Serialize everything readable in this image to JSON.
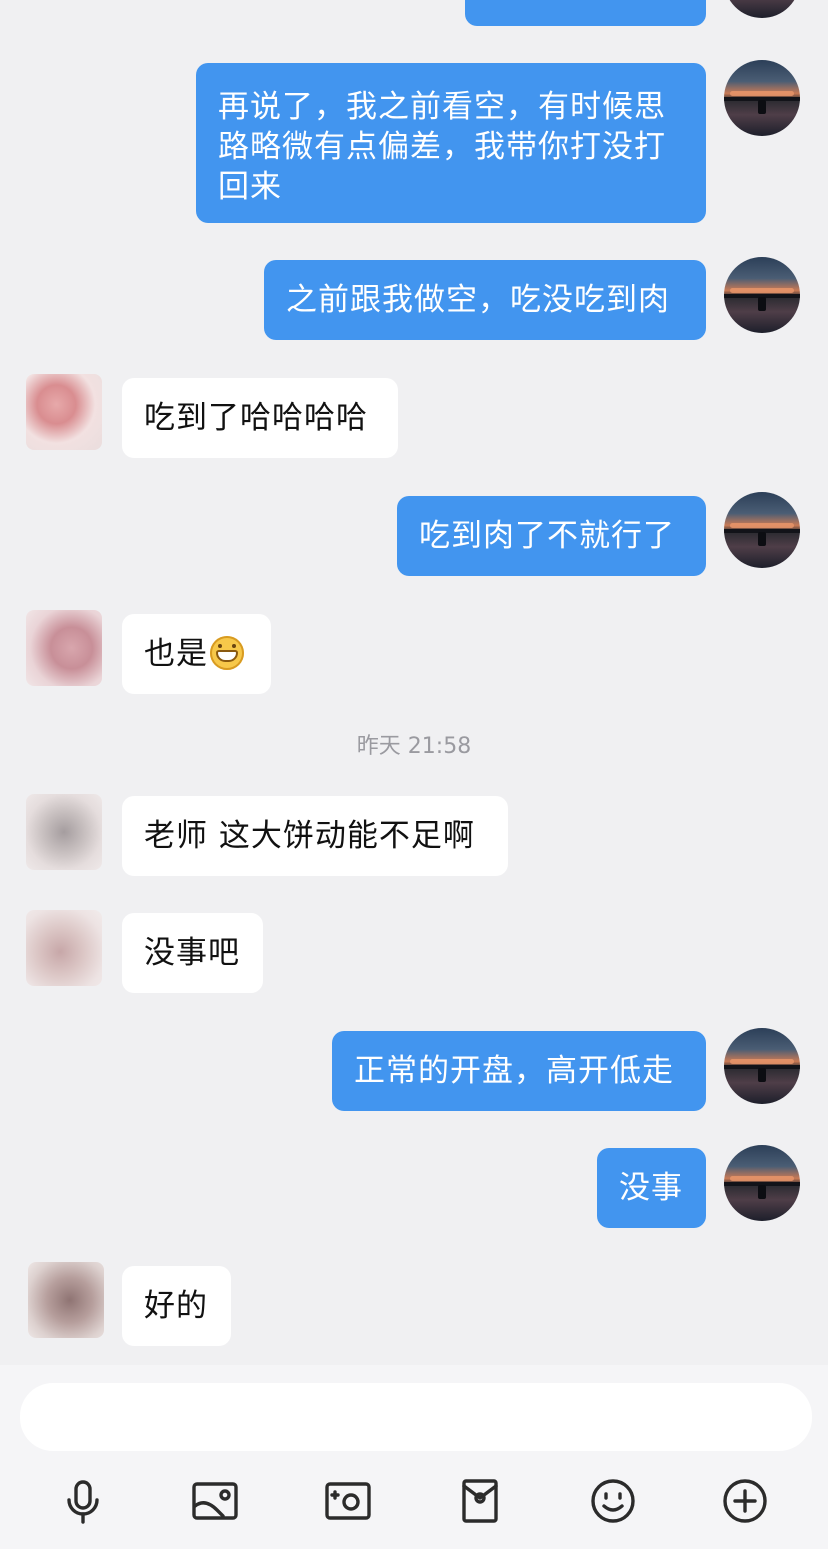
{
  "messages": [
    {
      "side": "me",
      "text": ""
    },
    {
      "side": "me",
      "text": "再说了，我之前看空，有时候思路略微有点偏差，我带你打没打回来"
    },
    {
      "side": "me",
      "text": "之前跟我做空，吃没吃到肉"
    },
    {
      "side": "them",
      "text": "吃到了哈哈哈哈"
    },
    {
      "side": "me",
      "text": "吃到肉了不就行了"
    },
    {
      "side": "them",
      "text": "也是",
      "emoji": "grin-emoji"
    },
    {
      "side": "them",
      "text": "老师 这大饼动能不足啊"
    },
    {
      "side": "them",
      "text": "没事吧"
    },
    {
      "side": "me",
      "text": "正常的开盘，高开低走"
    },
    {
      "side": "me",
      "text": "没事"
    },
    {
      "side": "them",
      "text": "好的"
    }
  ],
  "timestamp": "昨天 21:58",
  "input": {
    "placeholder": ""
  },
  "toolbar": [
    "microphone-icon",
    "image-icon",
    "camera-icon",
    "red-packet-icon",
    "emoji-icon",
    "plus-icon"
  ],
  "colors": {
    "my_bubble": "#4295ef",
    "their_bubble": "#ffffff",
    "background": "#f0f0f2"
  }
}
